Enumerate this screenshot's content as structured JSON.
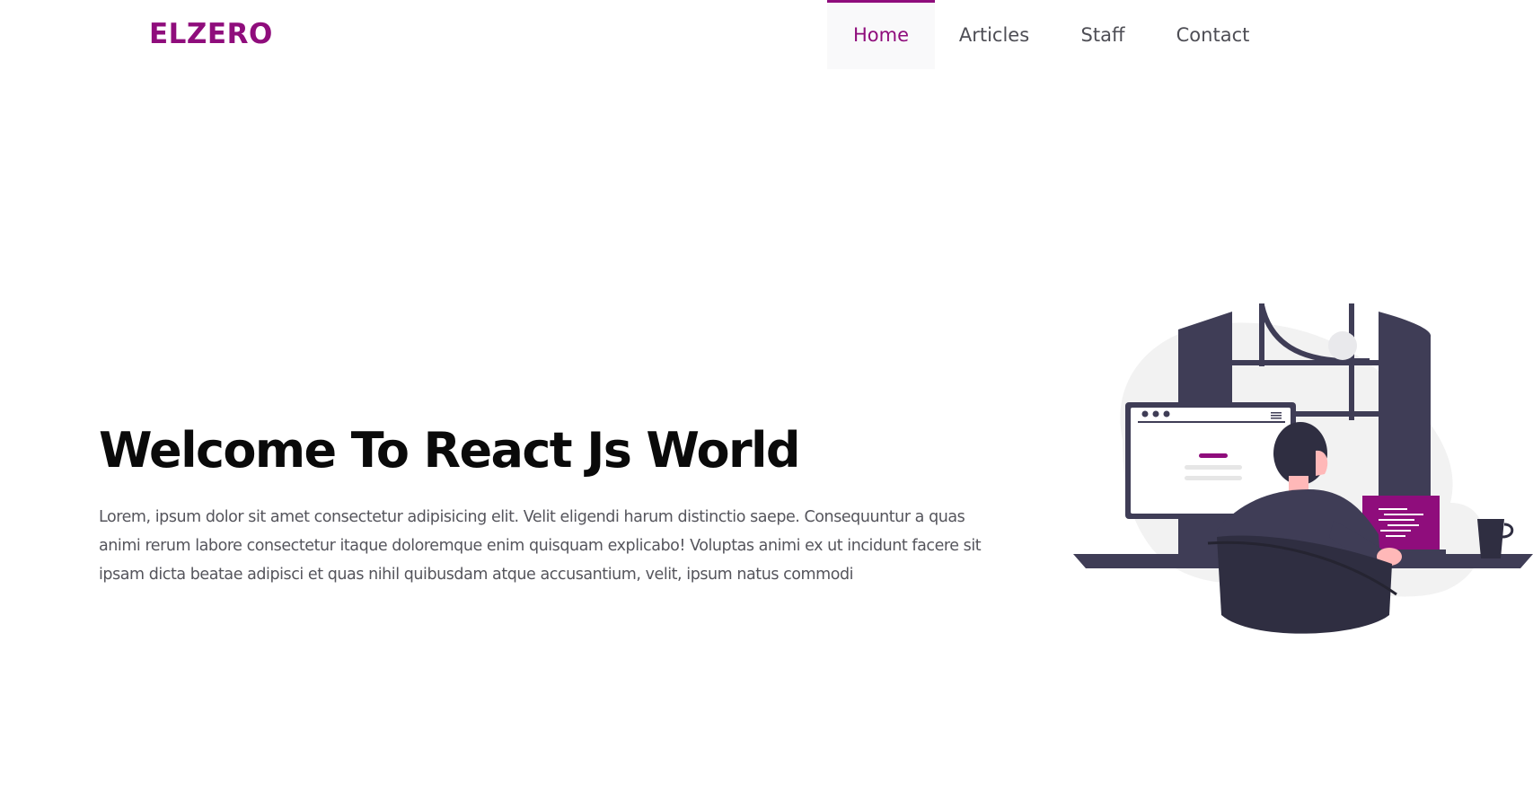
{
  "header": {
    "logo": "ELZERO",
    "nav": [
      {
        "label": "Home",
        "active": true
      },
      {
        "label": "Articles",
        "active": false
      },
      {
        "label": "Staff",
        "active": false
      },
      {
        "label": "Contact",
        "active": false
      }
    ]
  },
  "hero": {
    "title": "Welcome To React Js World",
    "text": "Lorem, ipsum dolor sit amet consectetur adipisicing elit. Velit eligendi harum distinctio saepe. Consequuntur a quas animi rerum labore consectetur itaque doloremque enim quisquam explicabo! Voluptas animi ex ut incidunt facere sit ipsam dicta beatae adipisci et quas nihil quibusdam atque accusantium, velit, ipsum natus commodi"
  },
  "colors": {
    "accent": "#8f0d7c",
    "dark": "#3f3d56",
    "text": "#55555c"
  },
  "illustration": {
    "icon": "developer-at-desk-illustration"
  }
}
